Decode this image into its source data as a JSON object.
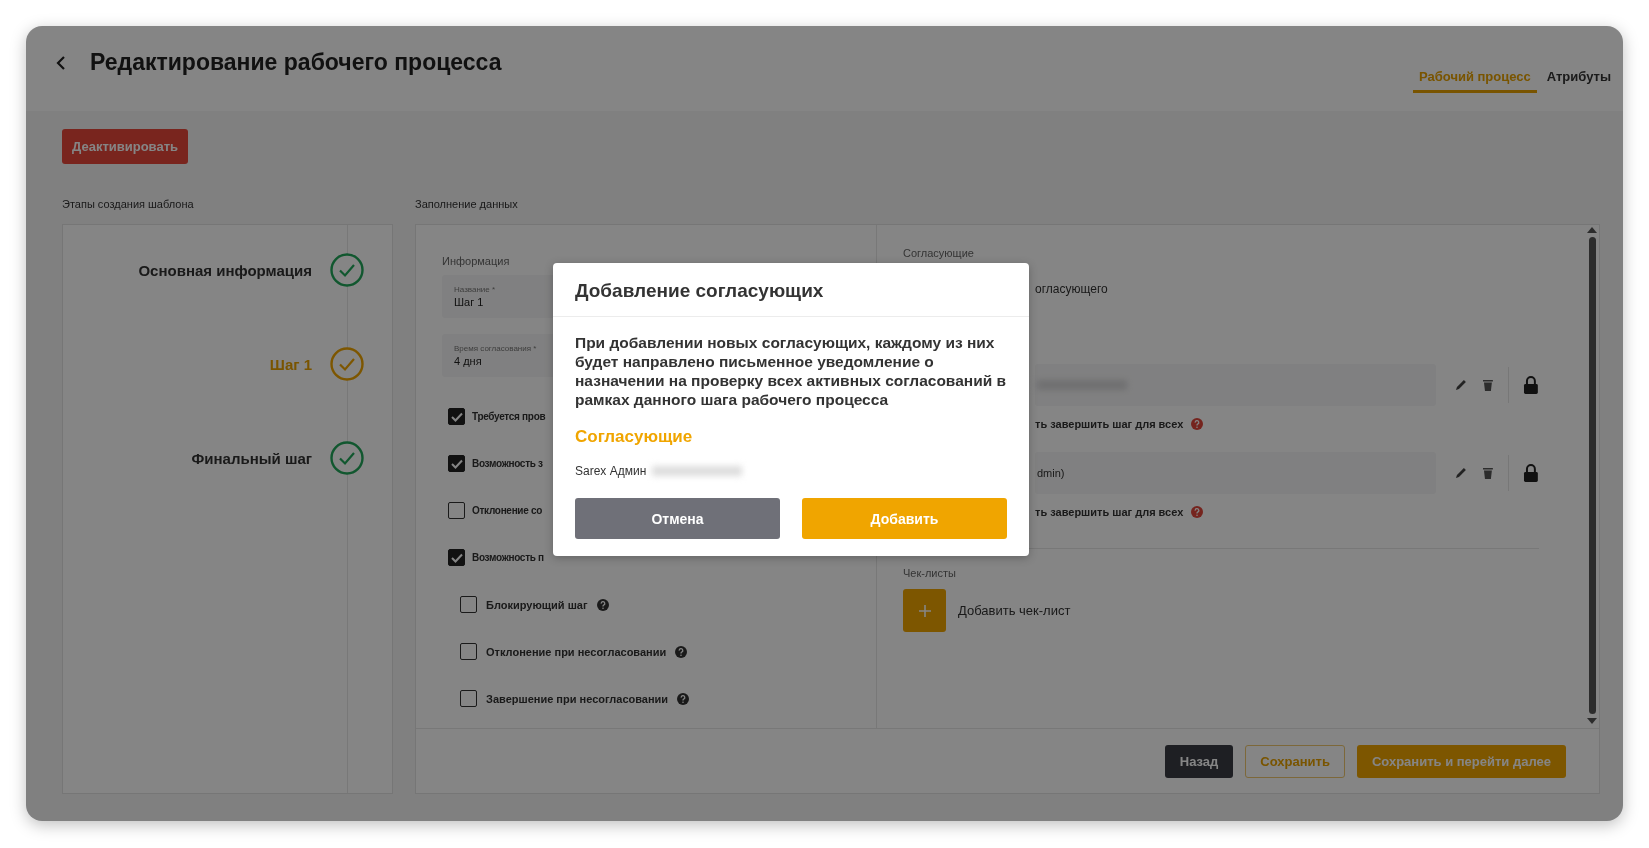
{
  "page_title": "Редактирование рабочего процесса",
  "tabs": [
    {
      "label": "Рабочий процесс",
      "selected": true
    },
    {
      "label": "Атрибуты",
      "selected": false
    }
  ],
  "deactivate_button": "Деактивировать",
  "stages": {
    "label": "Этапы создания шаблона",
    "steps": [
      {
        "label": "Основная информация",
        "selected": false,
        "done": true
      },
      {
        "label": "Шаг 1",
        "selected": true,
        "done": true
      },
      {
        "label": "Финальный шаг",
        "selected": false,
        "done": true
      }
    ]
  },
  "form": {
    "label": "Заполнение данных",
    "info_label": "Информация",
    "fields": [
      {
        "label": "Название *",
        "value": "Шаг 1"
      },
      {
        "label": "Время согласования *",
        "value": "4 дня"
      }
    ],
    "options": [
      {
        "label": "Требуется пров",
        "checked": true
      },
      {
        "label": "Возможность з",
        "checked": true
      },
      {
        "label": "Отклонение со",
        "checked": false
      },
      {
        "label": "Возможность п",
        "checked": true,
        "children": [
          {
            "label": "Блокирующий шаг",
            "checked": false,
            "help": true
          },
          {
            "label": "Отклонение при несогласовании",
            "checked": false,
            "help": true
          },
          {
            "label": "Завершение при несогласовании",
            "checked": false,
            "help": true
          }
        ]
      }
    ]
  },
  "approvers": {
    "label": "Согласующие",
    "add_label": "огласующего",
    "items": [
      {
        "redacted": true,
        "option": "ть завершить шаг для всех"
      },
      {
        "redacted": false,
        "value": "dmin)",
        "option": "ть завершить шаг для всех"
      }
    ]
  },
  "checklists": {
    "label": "Чек-листы",
    "add_label": "Добавить чек-лист"
  },
  "footer_buttons": [
    {
      "label": "Назад",
      "kind": "dark"
    },
    {
      "label": "Сохранить",
      "kind": "outline"
    },
    {
      "label": "Сохранить и перейти далее",
      "kind": "primary"
    }
  ],
  "modal": {
    "title": "Добавление согласующих",
    "message": "При добавлении новых согласующих, каждому из них будет направлено письменное уведомление о назначении на проверку всех активных согласований в рамках данного шага рабочего процесса",
    "section_title": "Согласующие",
    "approver": {
      "name": "Sarex Админ",
      "redacted": true
    },
    "buttons": [
      {
        "label": "Отмена",
        "kind": "cancel"
      },
      {
        "label": "Добавить",
        "kind": "primary"
      }
    ]
  }
}
